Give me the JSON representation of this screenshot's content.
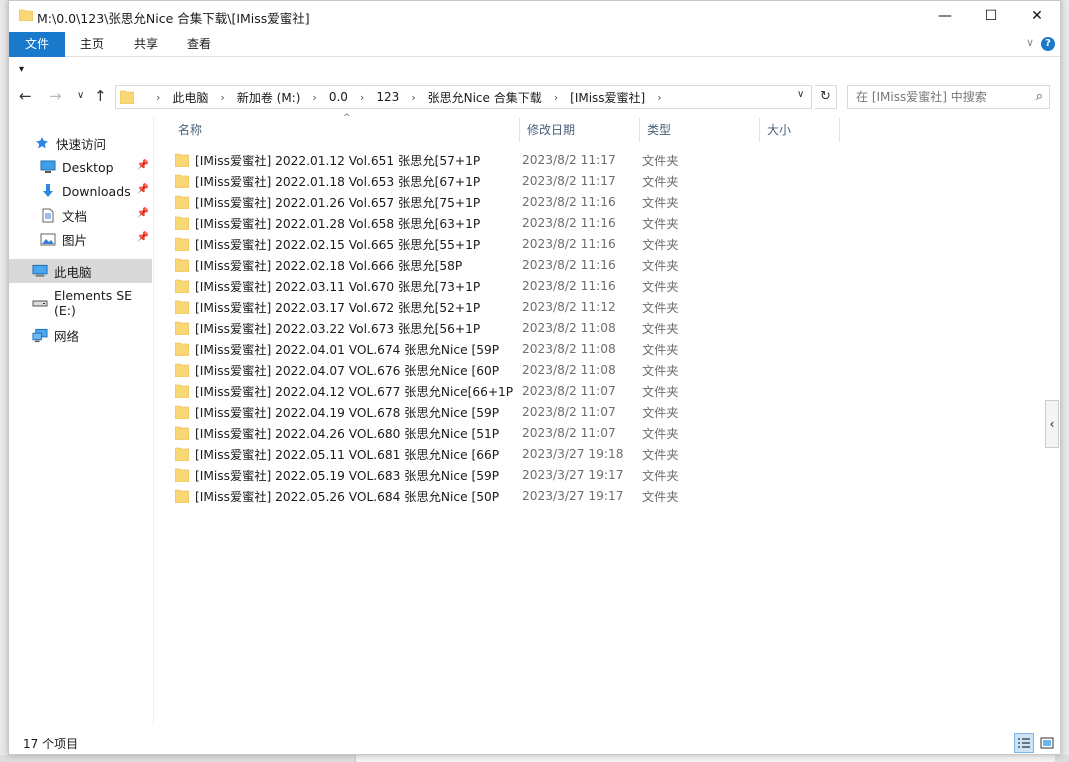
{
  "window": {
    "title": "M:\\0.0\\123\\张思允Nice 合集下载\\[IMiss爱蜜社]",
    "min": "—",
    "max": "☐",
    "close": "✕"
  },
  "ribbon": {
    "tabs": [
      "文件",
      "主页",
      "共享",
      "查看"
    ],
    "expand": "∨",
    "help": "?"
  },
  "qat": "▾",
  "nav": {
    "back": "←",
    "forward": "→",
    "recent": "∨",
    "up": "↑",
    "crumbs": [
      "此电脑",
      "新加卷 (M:)",
      "0.0",
      "123",
      "张思允Nice 合集下载",
      "[IMiss爱蜜社]"
    ],
    "sep": "›",
    "dropdown": "∨",
    "refresh": "↻",
    "search_placeholder": "在 [IMiss爱蜜社] 中搜索",
    "search_icon": "⌕"
  },
  "sidebar": {
    "items": [
      {
        "label": "快速访问",
        "icon": "star-icon"
      },
      {
        "label": "Desktop",
        "icon": "desktop-icon",
        "pinned": true
      },
      {
        "label": "Downloads",
        "icon": "download-icon",
        "pinned": true
      },
      {
        "label": "文档",
        "icon": "document-icon",
        "pinned": true
      },
      {
        "label": "图片",
        "icon": "picture-icon",
        "pinned": true
      },
      {
        "label": "此电脑",
        "icon": "computer-icon",
        "selected": true
      },
      {
        "label": "Elements SE (E:)",
        "icon": "drive-icon"
      },
      {
        "label": "网络",
        "icon": "network-icon"
      }
    ],
    "pin": "📌"
  },
  "columns": [
    "名称",
    "修改日期",
    "类型",
    "大小"
  ],
  "sort_arrow": "^",
  "files": [
    {
      "name": "[IMiss爱蜜社] 2022.01.12 Vol.651 张思允[57+1P",
      "date": "2023/8/2 11:17",
      "type": "文件夹"
    },
    {
      "name": "[IMiss爱蜜社] 2022.01.18 Vol.653 张思允[67+1P",
      "date": "2023/8/2 11:17",
      "type": "文件夹"
    },
    {
      "name": "[IMiss爱蜜社] 2022.01.26 Vol.657 张思允[75+1P",
      "date": "2023/8/2 11:16",
      "type": "文件夹"
    },
    {
      "name": "[IMiss爱蜜社] 2022.01.28 Vol.658 张思允[63+1P",
      "date": "2023/8/2 11:16",
      "type": "文件夹"
    },
    {
      "name": "[IMiss爱蜜社] 2022.02.15 Vol.665 张思允[55+1P",
      "date": "2023/8/2 11:16",
      "type": "文件夹"
    },
    {
      "name": "[IMiss爱蜜社] 2022.02.18 Vol.666 张思允[58P",
      "date": "2023/8/2 11:16",
      "type": "文件夹"
    },
    {
      "name": "[IMiss爱蜜社] 2022.03.11 Vol.670 张思允[73+1P",
      "date": "2023/8/2 11:16",
      "type": "文件夹"
    },
    {
      "name": "[IMiss爱蜜社] 2022.03.17 Vol.672 张思允[52+1P",
      "date": "2023/8/2 11:12",
      "type": "文件夹"
    },
    {
      "name": "[IMiss爱蜜社] 2022.03.22 Vol.673 张思允[56+1P",
      "date": "2023/8/2 11:08",
      "type": "文件夹"
    },
    {
      "name": "[IMiss爱蜜社] 2022.04.01 VOL.674 张思允Nice [59P",
      "date": "2023/8/2 11:08",
      "type": "文件夹"
    },
    {
      "name": "[IMiss爱蜜社] 2022.04.07 VOL.676 张思允Nice [60P",
      "date": "2023/8/2 11:08",
      "type": "文件夹"
    },
    {
      "name": "[IMiss爱蜜社] 2022.04.12 VOL.677 张思允Nice[66+1P",
      "date": "2023/8/2 11:07",
      "type": "文件夹"
    },
    {
      "name": "[IMiss爱蜜社] 2022.04.19 VOL.678 张思允Nice [59P",
      "date": "2023/8/2 11:07",
      "type": "文件夹"
    },
    {
      "name": "[IMiss爱蜜社] 2022.04.26 VOL.680 张思允Nice [51P",
      "date": "2023/8/2 11:07",
      "type": "文件夹"
    },
    {
      "name": "[IMiss爱蜜社] 2022.05.11 VOL.681 张思允Nice [66P",
      "date": "2023/3/27 19:18",
      "type": "文件夹"
    },
    {
      "name": "[IMiss爱蜜社] 2022.05.19 VOL.683 张思允Nice [59P",
      "date": "2023/3/27 19:17",
      "type": "文件夹"
    },
    {
      "name": "[IMiss爱蜜社] 2022.05.26 VOL.684 张思允Nice [50P",
      "date": "2023/3/27 19:17",
      "type": "文件夹"
    }
  ],
  "scroll_tab": "‹",
  "status": {
    "count": "17 个项目"
  },
  "colors": {
    "accent": "#1979ca",
    "folder": "#f8d775",
    "folder_dark": "#e8b43a"
  }
}
